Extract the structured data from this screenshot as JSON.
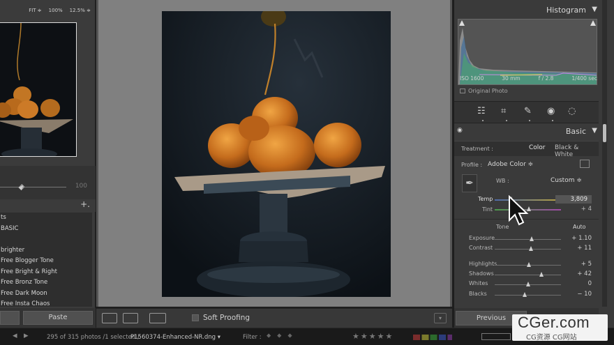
{
  "navigator": {
    "zoom_fit": "FIT ≑",
    "zoom_100": "100%",
    "zoom_125": "12.5% ≑"
  },
  "left_slider": {
    "value": "100"
  },
  "presets": {
    "add_label": "+.",
    "items": [
      "ts",
      "BASIC",
      "",
      "brighter",
      "Free Blogger Tone",
      "Free Bright & Right",
      "Free Bronz Tone",
      "Free Dark Moon",
      "Free Insta Chaos"
    ]
  },
  "left_bottom": {
    "paste_label": "Paste"
  },
  "toolbar": {
    "soft_proofing_label": "Soft Proofing",
    "icons": [
      "loupe-view-icon",
      "before-after-icon",
      "yy-compare-icon"
    ]
  },
  "histogram": {
    "title": "Histogram",
    "iso": "ISO 1600",
    "focal": "30 mm",
    "aperture": "f / 2.8",
    "shutter": "1/400 sec",
    "original_photo_label": "Original Photo"
  },
  "basic": {
    "title": "Basic",
    "treatment_label": "Treatment :",
    "treatment_color": "Color",
    "treatment_bw": "Black & White",
    "profile_label": "Profile :",
    "profile_value": "Adobe Color ≑",
    "wb_label": "WB :",
    "wb_value": "Custom ≑",
    "temp_label": "Temp",
    "temp_value": "3,809",
    "tint_label": "Tint",
    "tint_value": "+ 4",
    "tone_label": "Tone",
    "auto_label": "Auto",
    "sliders": [
      {
        "label": "Exposure",
        "value": "+ 1.10",
        "pos": 0.56
      },
      {
        "label": "Contrast",
        "value": "+ 11",
        "pos": 0.55
      },
      {
        "label": "Highlights",
        "value": "+ 5",
        "pos": 0.52
      },
      {
        "label": "Shadows",
        "value": "+ 42",
        "pos": 0.71
      },
      {
        "label": "Whites",
        "value": "0",
        "pos": 0.5
      },
      {
        "label": "Blacks",
        "value": "− 10",
        "pos": 0.45
      }
    ],
    "temp_pos": 0.25,
    "tint_pos": 0.52
  },
  "right_bottom": {
    "previous_label": "Previous"
  },
  "status": {
    "photo_count": "295 of 315 photos /1 selected /",
    "filename": "P1560374-Enhanced-NR.dng ▾",
    "filter_label": "Filter :"
  },
  "watermark": {
    "line1": "CGer.com",
    "line2": "CG资源  CG网站"
  }
}
